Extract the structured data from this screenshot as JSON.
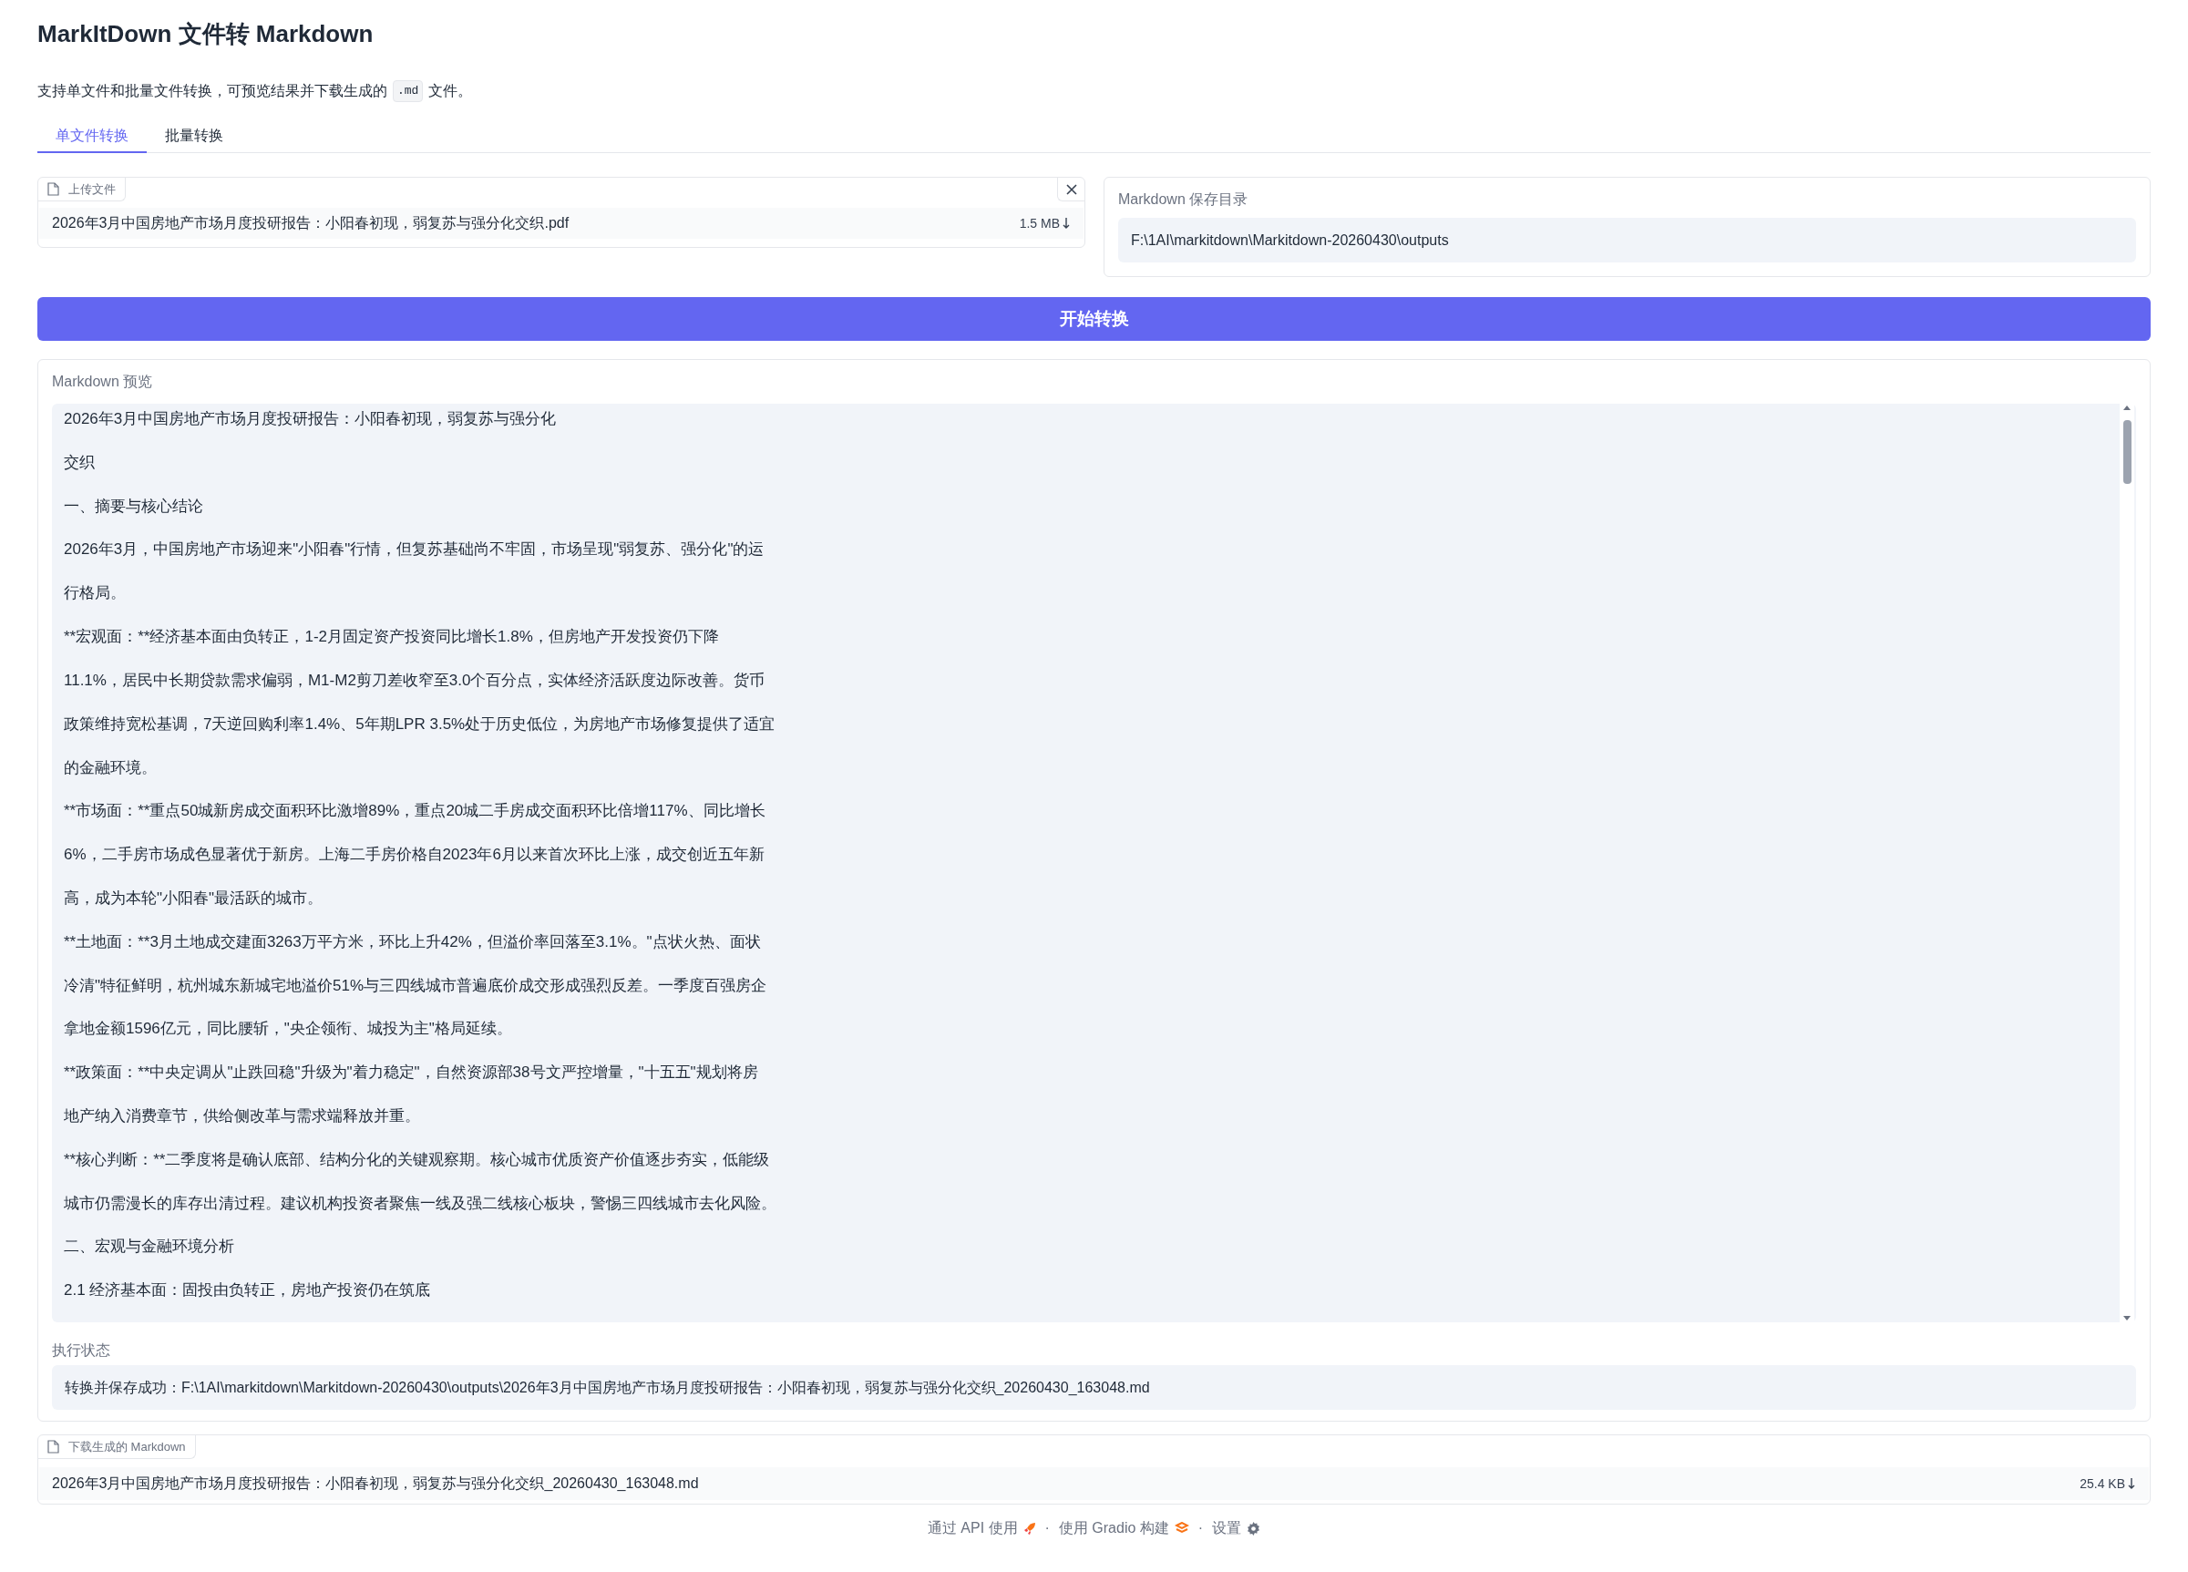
{
  "title": "MarkItDown 文件转 Markdown",
  "description": {
    "before": "支持单文件和批量文件转换，可预览结果并下载生成的",
    "code": ".md",
    "after": "文件。"
  },
  "tabs": [
    {
      "label": "单文件转换",
      "selected": true
    },
    {
      "label": "批量转换",
      "selected": false
    }
  ],
  "upload": {
    "label": "上传文件",
    "file_name": "2026年3月中国房地产市场月度投研报告：小阳春初现，弱复苏与强分化交织.pdf",
    "file_size": "1.5 MB"
  },
  "save_dir": {
    "label": "Markdown 保存目录",
    "value": "F:\\1AI\\markitdown\\Markitdown-20260430\\outputs"
  },
  "convert_button": "开始转换",
  "preview": {
    "label": "Markdown 预览",
    "lines": [
      "2026年3月中国房地产市场月度投研报告：小阳春初现，弱复苏与强分化",
      "交织",
      "一、摘要与核心结论",
      "2026年3月，中国房地产市场迎来\"小阳春\"行情，但复苏基础尚不牢固，市场呈现\"弱复苏、强分化\"的运",
      "行格局。",
      "**宏观面：**经济基本面由负转正，1-2月固定资产投资同比增长1.8%，但房地产开发投资仍下降",
      "11.1%，居民中长期贷款需求偏弱，M1-M2剪刀差收窄至3.0个百分点，实体经济活跃度边际改善。货币",
      "政策维持宽松基调，7天逆回购利率1.4%、5年期LPR 3.5%处于历史低位，为房地产市场修复提供了适宜",
      "的金融环境。",
      "**市场面：**重点50城新房成交面积环比激增89%，重点20城二手房成交面积环比倍增117%、同比增长",
      "6%，二手房市场成色显著优于新房。上海二手房价格自2023年6月以来首次环比上涨，成交创近五年新",
      "高，成为本轮\"小阳春\"最活跃的城市。",
      "**土地面：**3月土地成交建面3263万平方米，环比上升42%，但溢价率回落至3.1%。\"点状火热、面状",
      "冷清\"特征鲜明，杭州城东新城宅地溢价51%与三四线城市普遍底价成交形成强烈反差。一季度百强房企",
      "拿地金额1596亿元，同比腰斩，\"央企领衔、城投为主\"格局延续。",
      "**政策面：**中央定调从\"止跌回稳\"升级为\"着力稳定\"，自然资源部38号文严控增量，\"十五五\"规划将房",
      "地产纳入消费章节，供给侧改革与需求端释放并重。",
      "**核心判断：**二季度将是确认底部、结构分化的关键观察期。核心城市优质资产价值逐步夯实，低能级",
      "城市仍需漫长的库存出清过程。建议机构投资者聚焦一线及强二线核心板块，警惕三四线城市去化风险。",
      "二、宏观与金融环境分析",
      "2.1 经济基本面：固投由负转正，房地产投资仍在筑底"
    ]
  },
  "status": {
    "label": "执行状态",
    "value": "转换并保存成功：F:\\1AI\\markitdown\\Markitdown-20260430\\outputs\\2026年3月中国房地产市场月度投研报告：小阳春初现，弱复苏与强分化交织_20260430_163048.md"
  },
  "download": {
    "label": "下载生成的 Markdown",
    "file_name": "2026年3月中国房地产市场月度投研报告：小阳春初现，弱复苏与强分化交织_20260430_163048.md",
    "file_size": "25.4 KB"
  },
  "footer": [
    {
      "kind": "api",
      "label": "通过 API 使用"
    },
    {
      "kind": "gradio",
      "label": "使用 Gradio 构建"
    },
    {
      "kind": "settings",
      "label": "设置"
    }
  ],
  "footer_separator": "·"
}
